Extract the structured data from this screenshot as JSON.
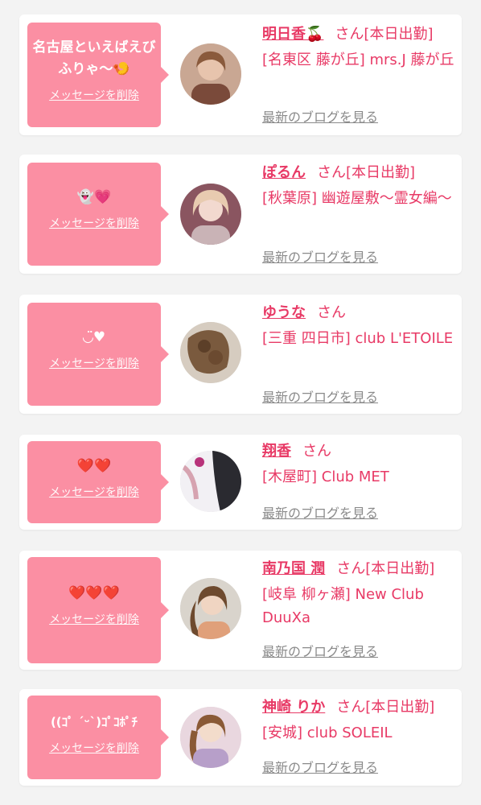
{
  "entries": [
    {
      "message": "名古屋といえばえびふりゃ〜🍤",
      "delete_label": "メッセージを削除",
      "name": "明日香🍒",
      "honorific": "さん",
      "status": "[本日出勤]",
      "shop": "[名東区 藤が丘] mrs.J 藤が丘",
      "blog_label": "最新のブログを見る"
    },
    {
      "message": "👻💗",
      "delete_label": "メッセージを削除",
      "name": "ぽるん",
      "honorific": "さん",
      "status": "[本日出勤]",
      "shop": "[秋葉原] 幽遊屋敷〜霊女編〜",
      "blog_label": "最新のブログを見る"
    },
    {
      "message": "◡̈♥︎",
      "delete_label": "メッセージを削除",
      "name": "ゆうな",
      "honorific": "さん",
      "status": "",
      "shop": "[三重 四日市] club L'ETOILE",
      "blog_label": "最新のブログを見る"
    },
    {
      "message": "❤️❤️",
      "delete_label": "メッセージを削除",
      "name": "翔香",
      "honorific": "さん",
      "status": "",
      "shop": "[木屋町] Club MET",
      "blog_label": "最新のブログを見る"
    },
    {
      "message": "❤️❤️❤️",
      "delete_label": "メッセージを削除",
      "name": "南乃国 潤",
      "honorific": "さん",
      "status": "[本日出勤]",
      "shop": "[岐阜 柳ヶ瀬] New Club DuuXa",
      "blog_label": "最新のブログを見る"
    },
    {
      "message": "((ｺﾟ ´ᵕ`)ｺﾟｺﾎﾟﾁ",
      "delete_label": "メッセージを削除",
      "name": "神崎 りか",
      "honorific": "さん",
      "status": "[本日出勤]",
      "shop": "[安城] club SOLEIL",
      "blog_label": "最新のブログを見る"
    }
  ],
  "colors": {
    "background": "#f3f3f3",
    "card": "#ffffff",
    "bubble": "#fb8fa3",
    "accent": "#e83a66",
    "muted": "#8a8a8a"
  }
}
